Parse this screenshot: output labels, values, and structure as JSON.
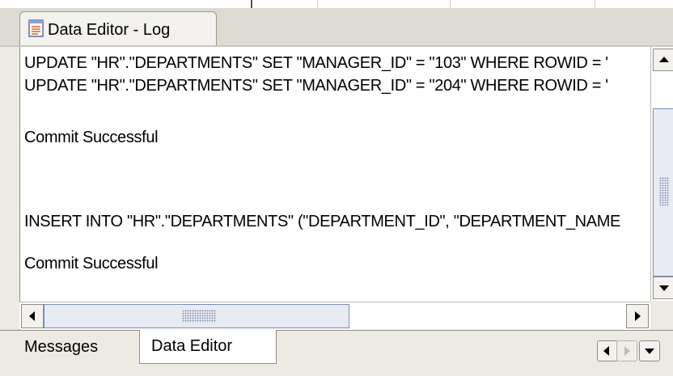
{
  "window": {
    "title": "Data Editor - Log"
  },
  "log": {
    "lines": [
      "UPDATE \"HR\".\"DEPARTMENTS\" SET \"MANAGER_ID\" = \"103\" WHERE ROWID = '",
      "UPDATE \"HR\".\"DEPARTMENTS\" SET \"MANAGER_ID\" = \"204\" WHERE ROWID = '",
      "Commit Successful",
      "INSERT INTO \"HR\".\"DEPARTMENTS\" (\"DEPARTMENT_ID\", \"DEPARTMENT_NAME",
      "Commit Successful"
    ]
  },
  "bottom_tabs": {
    "messages": "Messages",
    "data_editor": "Data Editor",
    "active": "Data Editor"
  },
  "icons": {
    "tab_icon": "log-document-icon",
    "scroll_up": "arrow-up-icon",
    "scroll_down": "arrow-down-icon",
    "scroll_left": "arrow-left-icon",
    "scroll_right": "arrow-right-icon",
    "tab_prev": "tab-scroll-left-icon",
    "tab_next": "tab-scroll-right-icon",
    "tab_menu": "tab-list-dropdown-icon"
  },
  "colors": {
    "panel_bg": "#ffffff",
    "chrome_bg": "#eceae3",
    "scroll_thumb": "#e9ebf3",
    "scroll_thumb_border": "#7b8fb3"
  }
}
